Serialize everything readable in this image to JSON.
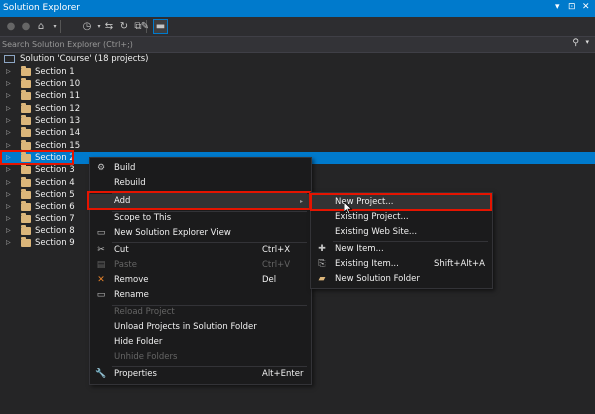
{
  "window": {
    "title": "Solution Explorer",
    "controls": [
      "▾",
      "⊡",
      "✕"
    ]
  },
  "toolbar": {
    "icons": [
      "back-icon",
      "forward-icon",
      "home-icon",
      "sync-history-icon",
      "sync-icon",
      "refresh-icon",
      "properties-icon",
      "preview-icon"
    ]
  },
  "search": {
    "placeholder": "Search Solution Explorer (Ctrl+;)"
  },
  "tree": {
    "solution_label": "Solution 'Course' (18 projects)",
    "items": [
      {
        "label": "Section 1"
      },
      {
        "label": "Section 10"
      },
      {
        "label": "Section 11"
      },
      {
        "label": "Section 12"
      },
      {
        "label": "Section 13"
      },
      {
        "label": "Section 14"
      },
      {
        "label": "Section 15"
      },
      {
        "label": "Section 2",
        "selected": true
      },
      {
        "label": "Section 3"
      },
      {
        "label": "Section 4"
      },
      {
        "label": "Section 5"
      },
      {
        "label": "Section 6"
      },
      {
        "label": "Section 7"
      },
      {
        "label": "Section 8"
      },
      {
        "label": "Section 9"
      }
    ]
  },
  "context_menu": {
    "items": [
      {
        "label": "Build",
        "icon": "build-icon",
        "shortcut": ""
      },
      {
        "label": "Rebuild",
        "icon": "",
        "shortcut": ""
      },
      {
        "label": "Add",
        "icon": "",
        "shortcut": "",
        "submenu": true,
        "highlighted": true
      },
      {
        "label": "Scope to This",
        "icon": "",
        "shortcut": ""
      },
      {
        "label": "New Solution Explorer View",
        "icon": "new-view-icon",
        "shortcut": ""
      },
      {
        "label": "Cut",
        "icon": "cut-icon",
        "shortcut": "Ctrl+X"
      },
      {
        "label": "Paste",
        "icon": "paste-icon",
        "shortcut": "Ctrl+V",
        "disabled": true
      },
      {
        "label": "Remove",
        "icon": "remove-icon",
        "shortcut": "Del"
      },
      {
        "label": "Rename",
        "icon": "rename-icon",
        "shortcut": ""
      },
      {
        "label": "Reload Project",
        "icon": "",
        "shortcut": "",
        "disabled": true
      },
      {
        "label": "Unload Projects in Solution Folder",
        "icon": "",
        "shortcut": ""
      },
      {
        "label": "Hide Folder",
        "icon": "",
        "shortcut": ""
      },
      {
        "label": "Unhide Folders",
        "icon": "",
        "shortcut": "",
        "disabled": true
      },
      {
        "label": "Properties",
        "icon": "wrench-icon",
        "shortcut": "Alt+Enter"
      }
    ]
  },
  "submenu": {
    "items": [
      {
        "label": "New Project...",
        "icon": "",
        "shortcut": "",
        "highlighted": true
      },
      {
        "label": "Existing Project...",
        "icon": "",
        "shortcut": ""
      },
      {
        "label": "Existing Web Site...",
        "icon": "",
        "shortcut": ""
      },
      {
        "label": "New Item...",
        "icon": "new-item-icon",
        "shortcut": ""
      },
      {
        "label": "Existing Item...",
        "icon": "existing-item-icon",
        "shortcut": "Shift+Alt+A"
      },
      {
        "label": "New Solution Folder",
        "icon": "folder-icon",
        "shortcut": ""
      }
    ]
  },
  "colors": {
    "accent": "#007acc",
    "highlight_border": "#e51400",
    "folder": "#dcb67a",
    "background": "#252526"
  }
}
